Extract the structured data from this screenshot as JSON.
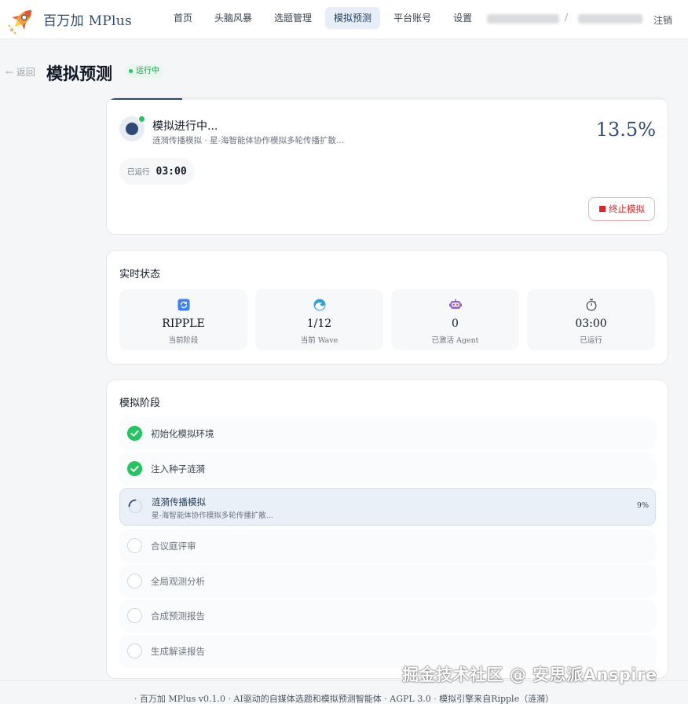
{
  "header": {
    "brand": "百万加 MPlus",
    "nav": [
      {
        "label": "首页",
        "active": false
      },
      {
        "label": "头脑风暴",
        "active": false
      },
      {
        "label": "选题管理",
        "active": false
      },
      {
        "label": "模拟预测",
        "active": true
      },
      {
        "label": "平台账号",
        "active": false
      },
      {
        "label": "设置",
        "active": false
      }
    ],
    "user_separator": "/",
    "logout_label": "注销"
  },
  "page": {
    "back_label": "← 返回",
    "title": "模拟预测",
    "status_badge": "运行中"
  },
  "simulation": {
    "title": "模拟进行中...",
    "subtitle": "涟漪传播模拟 · 星-海智能体协作模拟多轮传播扩散...",
    "percent_label": "13.5%",
    "progress": 0.135,
    "elapsed_label": "已运行",
    "elapsed_value": "03:00",
    "stop_label": "终止模拟"
  },
  "realtime": {
    "title": "实时状态",
    "stats": [
      {
        "icon": "refresh-icon",
        "value": "RIPPLE",
        "label": "当前阶段"
      },
      {
        "icon": "wave-icon",
        "value": "1/12",
        "label": "当前 Wave"
      },
      {
        "icon": "robot-icon",
        "value": "0",
        "label": "已激活 Agent"
      },
      {
        "icon": "stopwatch-icon",
        "value": "03:00",
        "label": "已运行"
      }
    ]
  },
  "phases": {
    "title": "模拟阶段",
    "items": [
      {
        "name": "初始化模拟环境",
        "status": "done"
      },
      {
        "name": "注入种子涟漪",
        "status": "done"
      },
      {
        "name": "涟漪传播模拟",
        "status": "active",
        "detail": "星-海智能体协作模拟多轮传播扩散...",
        "percent": "9%"
      },
      {
        "name": "合议庭评审",
        "status": "pending"
      },
      {
        "name": "全局观测分析",
        "status": "pending"
      },
      {
        "name": "合成预测报告",
        "status": "pending"
      },
      {
        "name": "生成解读报告",
        "status": "pending"
      }
    ]
  },
  "footer": {
    "text": "· 百万加 MPlus v0.1.0 · AI驱动的自媒体选题和模拟预测智能体 · AGPL 3.0 · 模拟引擎来自Ripple（涟漪）"
  },
  "watermark": "掘金技术社区 @ 安思派Anspire",
  "colors": {
    "brand": "#2c4a73",
    "success": "#22c55e",
    "danger": "#dc2626"
  }
}
